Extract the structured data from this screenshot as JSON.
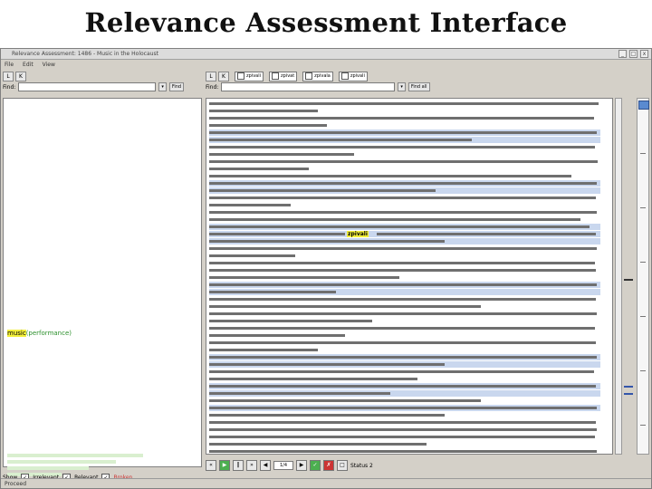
{
  "slide": {
    "title": "Relevance Assessment Interface"
  },
  "window": {
    "title": "Relevance Assessment: 1486 - Music in the Holocaust",
    "menu": [
      "File",
      "Edit",
      "View"
    ],
    "controls": [
      "_",
      "□",
      "x"
    ]
  },
  "left_panel": {
    "tabs": [
      "L",
      "K"
    ],
    "find_label": "Find:",
    "find_button": "Find",
    "hits": [
      {
        "keyword": "music",
        "rest": "(performance)"
      }
    ],
    "bottom": {
      "label": "Show",
      "options": [
        "Irrelevant",
        "Relevant",
        "Broken"
      ]
    }
  },
  "right_panel": {
    "tabs": [
      "L",
      "K"
    ],
    "filters": [
      "zpivali",
      "zpivat",
      "zpivala",
      "zpivali"
    ],
    "find_label": "Find:",
    "find_button": "Find all",
    "highlighted_term": "zpivali",
    "bottom": {
      "zoom": "1/4",
      "status": "Status 2"
    }
  },
  "status": {
    "text": "Proceed"
  },
  "colors": {
    "highlight_line": "#c9d7ee",
    "keyword": "#f2ef3a",
    "term": "#2a8f2a"
  }
}
